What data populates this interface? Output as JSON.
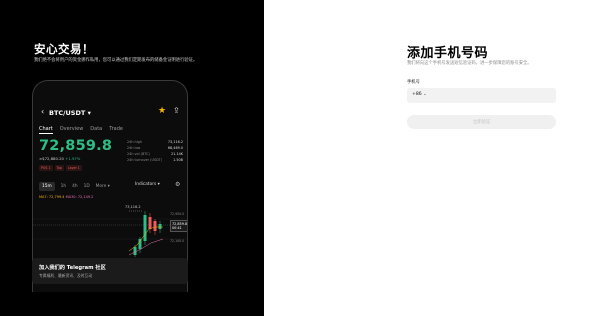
{
  "promo": {
    "title": "安心交易！",
    "description": "我们绝不会将用户的资金挪作私用，您可以通过我们定期发布的储备金证明进行验证。"
  },
  "phone_preview": {
    "pair": "BTC/USDT",
    "tabs": [
      "Chart",
      "Overview",
      "Data",
      "Trade"
    ],
    "active_tab": "Chart",
    "price": "72,859.8",
    "sub_price": "≈$72,880.20",
    "change": "+1.97%",
    "tags": [
      "POS 1",
      "Top",
      "Layer 1"
    ],
    "stats": [
      {
        "label": "24h high",
        "value": "73,116.2"
      },
      {
        "label": "24h low",
        "value": "68,469.0"
      },
      {
        "label": "24h vol (BTC)",
        "value": "21.14K"
      },
      {
        "label": "24h turnover (USDT)",
        "value": "1.50B"
      }
    ],
    "intervals": [
      "15m",
      "1h",
      "4h",
      "1D",
      "More"
    ],
    "active_interval": "15m",
    "indicators_label": "Indicators",
    "ma_line": {
      "prefix": "MA7: 72,799.4",
      "ma30": "MA30: 72,149.2"
    },
    "chart_high_label": "73,116.2",
    "axis_labels": [
      "72,950.0",
      "72,100.0"
    ],
    "price_tag": [
      "72,859.8",
      "00:41"
    ]
  },
  "community": {
    "title": "加入我们的 Telegram 社区",
    "description": "专属福利、最新资讯、及时互动"
  },
  "form": {
    "title": "添加手机号码",
    "subtitle": "我们将向这个手机号发送短信验证码，进一步保障您的账号安全。",
    "field_label": "手机号",
    "country_code": "+86",
    "phone_placeholder": "",
    "submit_label": "立即验证"
  }
}
